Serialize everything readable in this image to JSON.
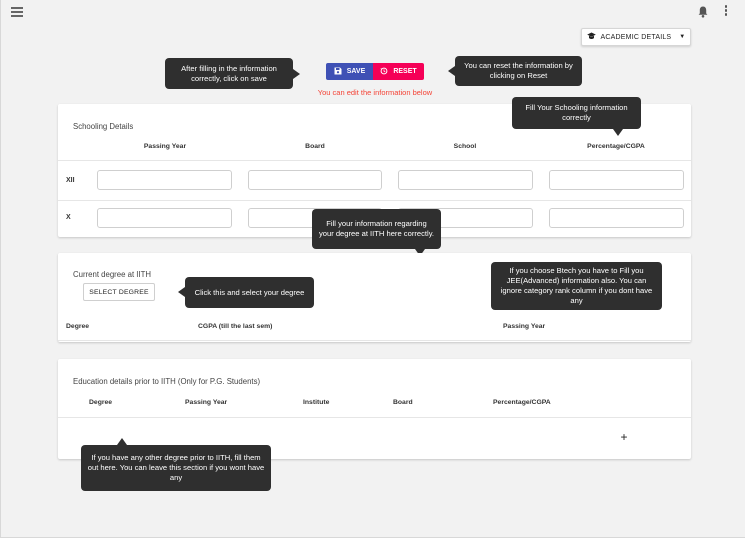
{
  "header": {
    "menu_icon": "hamburger-icon",
    "bell_icon": "bell-icon",
    "more_icon": "kebab-icon"
  },
  "academic_dropdown": {
    "label": "ACADEMIC DETAILS",
    "icon": "graduation-cap-icon",
    "caret": "▼"
  },
  "actions": {
    "save_label": "SAVE",
    "reset_label": "RESET",
    "edit_note": "You can edit the information below"
  },
  "tooltips": {
    "save": "After filling in the information correctly, click on save",
    "reset": "You can reset the information by clicking on Reset",
    "schooling": "Fill Your Schooling information correctly",
    "degree_info": "Fill your information regarding your degree at IITH here correctly.",
    "select_degree": "Click this and select your degree",
    "btech": "If you choose Btech you have to Fill you JEE(Advanced) information also. You can ignore category rank column if you dont have any",
    "prior": "If you have any other degree prior to IITH, fill them out here. You can leave this section if you wont have any"
  },
  "schooling": {
    "title": "Schooling Details",
    "columns": [
      "Passing Year",
      "Board",
      "School",
      "Percentage/CGPA"
    ],
    "rows": [
      {
        "label": "XII",
        "values": [
          "",
          "",
          "",
          ""
        ]
      },
      {
        "label": "X",
        "values": [
          "",
          "",
          "",
          ""
        ]
      }
    ]
  },
  "current_degree": {
    "title": "Current degree at IITH",
    "select_label": "SELECT DEGREE",
    "columns": [
      "Degree",
      "CGPA (till the last sem)",
      "Passing Year"
    ]
  },
  "prior_education": {
    "title": "Education details prior to IITH (Only for P.G. Students)",
    "columns": [
      "Degree",
      "Passing Year",
      "Institute",
      "Board",
      "Percentage/CGPA"
    ],
    "add_label": "+"
  },
  "colors": {
    "save": "#3f51b5",
    "reset": "#f50057",
    "note": "#f44336",
    "tooltip": "#2f2f2f",
    "background": "#f2f2f2"
  }
}
